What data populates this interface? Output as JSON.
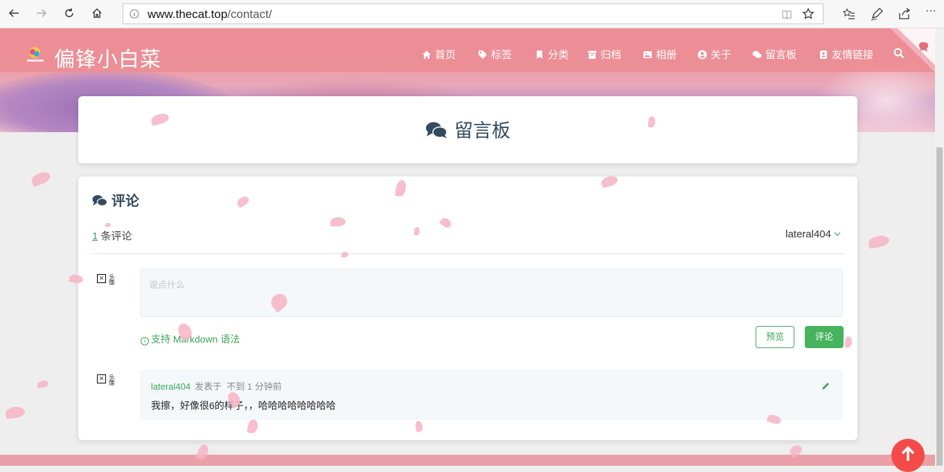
{
  "browser": {
    "url_host": "www.thecat.top",
    "url_path": "/contact/"
  },
  "site": {
    "title": "偏锋小白菜",
    "menu": [
      {
        "label": "首页",
        "icon": "home-icon"
      },
      {
        "label": "标签",
        "icon": "tags-icon"
      },
      {
        "label": "分类",
        "icon": "bookmark-icon"
      },
      {
        "label": "归档",
        "icon": "archive-icon"
      },
      {
        "label": "相册",
        "icon": "image-icon"
      },
      {
        "label": "关于",
        "icon": "user-circle-icon"
      },
      {
        "label": "留言板",
        "icon": "comments-icon"
      },
      {
        "label": "友情链接",
        "icon": "address-card-icon"
      }
    ]
  },
  "page": {
    "heading": "留言板"
  },
  "comments": {
    "section_title": "评论",
    "count": "1",
    "count_suffix": "条评论",
    "current_user": "lateral404",
    "placeholder": "说点什么",
    "markdown_hint": "支持 Markdown 语法",
    "preview_label": "预览",
    "submit_label": "评论",
    "avatar_alt": "头像",
    "items": [
      {
        "author": "lateral404",
        "verb": "发表于",
        "time": "不到 1 分钟前",
        "text": "我擦，好像很6的样子，，哈哈哈哈哈哈哈哈"
      }
    ]
  },
  "colors": {
    "accent_green": "#47b35c",
    "nav_pink": "#ec8c94",
    "back_to_top": "#f44b48"
  }
}
